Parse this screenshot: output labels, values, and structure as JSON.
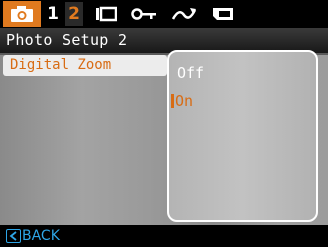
{
  "topbar": {
    "tabs": [
      {
        "icon": "camera-icon"
      },
      {
        "label": "1"
      },
      {
        "label": "2"
      },
      {
        "icon": "display-icon"
      },
      {
        "icon": "key-icon"
      },
      {
        "icon": "curve-icon"
      },
      {
        "icon": "card-icon"
      }
    ],
    "active_color": "#e07a1f"
  },
  "title": "Photo Setup 2",
  "menu": {
    "selected_item": "Digital Zoom"
  },
  "options": {
    "off_label": "Off",
    "on_label": "On",
    "selected": "On"
  },
  "footer": {
    "back_label": "BACK"
  },
  "colors": {
    "highlight": "#d86c14",
    "back": "#2ea5e6"
  }
}
